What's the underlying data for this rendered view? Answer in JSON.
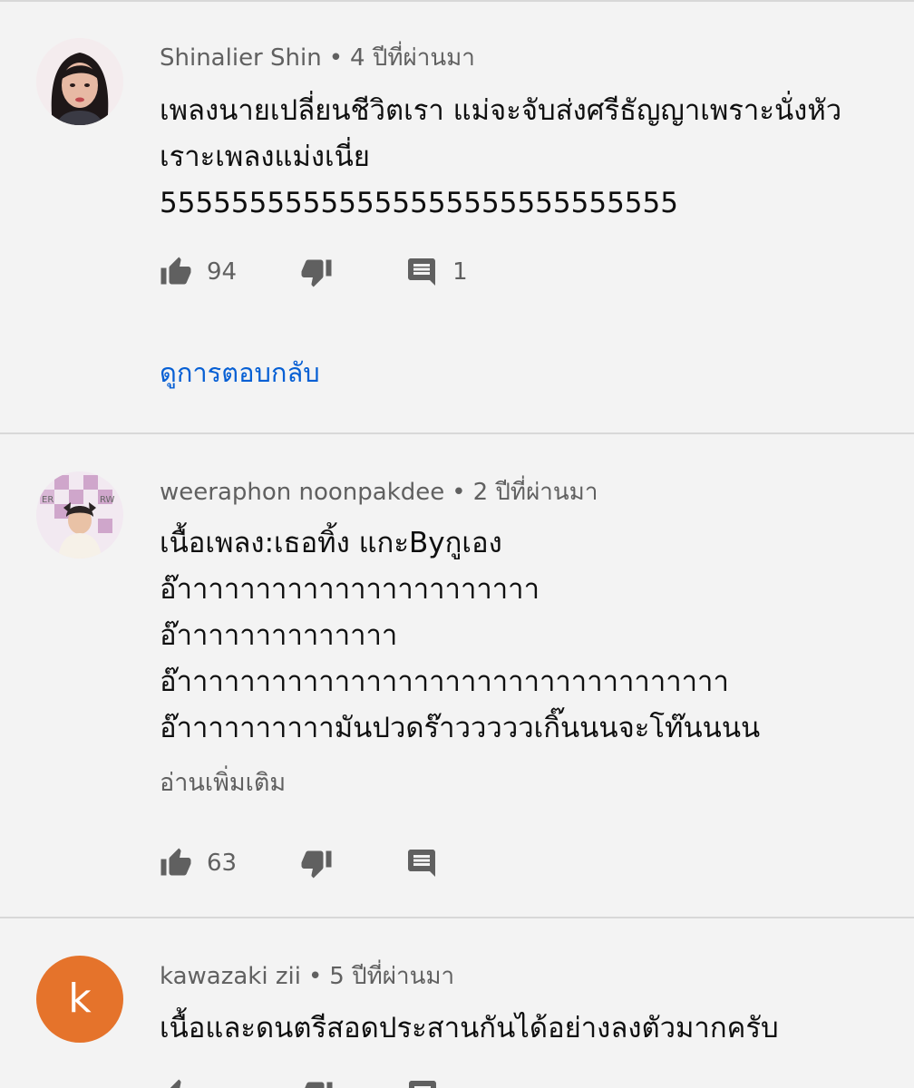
{
  "comments": [
    {
      "author": "Shinalier Shin",
      "time": "4 ปีที่ผ่านมา",
      "text": "เพลงนายเปลี่ยนชีวิตเรา แม่จะจับส่งศรีธัญญาเพราะนั่งหัว\nเราะเพลงแม่งเนี่ย\n55555555555555555555555555555",
      "likes": "94",
      "replies": "1",
      "view_replies_label": "ดูการตอบกลับ"
    },
    {
      "author": "weeraphon noonpakdee",
      "time": "2 ปีที่ผ่านมา",
      "text": "เนื้อเพลง:เธอทิ้ง แกะByกูเอง\nอ๊าาาาาาาาาาาาาาาาาาาาาาา\nอ๊าาาาาาาาาาาาาา\nอ๊าาาาาาาาาาาาาาาาาาาาาาาาาาาาาาาาาาา\nอ๊าาาาาาาาาามันปวดร๊าวววววเกิ๊นนนจะโท๊นนนน",
      "read_more_label": "อ่านเพิ่มเติม",
      "likes": "63"
    },
    {
      "author": "kawazaki zii",
      "avatar_letter": "k",
      "avatar_color": "#e5732b",
      "time": "5 ปีที่ผ่านมา",
      "text": "เนื้อและดนตรีสอดประสานกันได้อย่างลงตัวมากครับ"
    }
  ],
  "meta_separator": "•",
  "colors": {
    "background": "#f3f3f3",
    "link": "#065fd4",
    "secondary_text": "#606060"
  }
}
